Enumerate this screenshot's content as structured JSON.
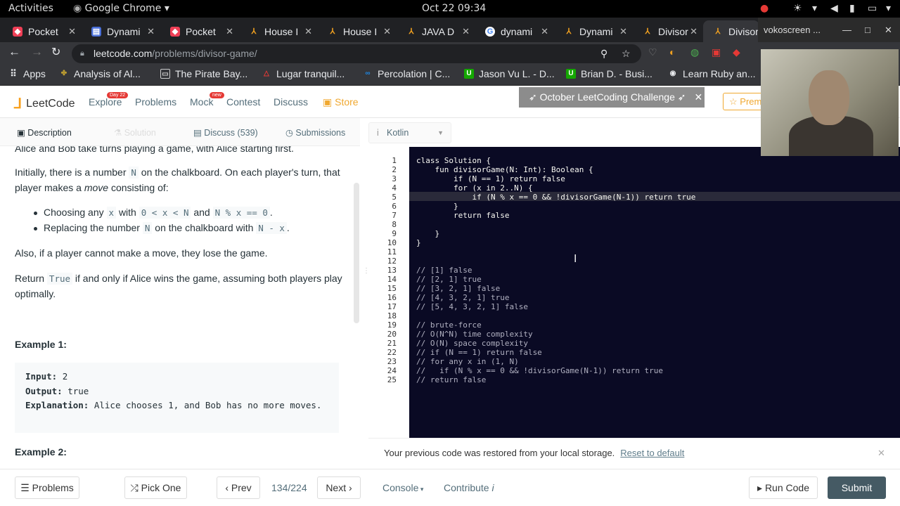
{
  "system": {
    "activities": "Activities",
    "app": "Google Chrome",
    "clock": "Oct 22  09:34"
  },
  "tabs": [
    {
      "label": "Pocket",
      "color": "#ef3f56"
    },
    {
      "label": "Dynami",
      "color": "#4a6fd8"
    },
    {
      "label": "Pocket",
      "color": "#ef3f56"
    },
    {
      "label": "House I",
      "color": "#f0a020"
    },
    {
      "label": "House I",
      "color": "#f0a020"
    },
    {
      "label": "JAVA D",
      "color": "#f0a020"
    },
    {
      "label": "dynami",
      "color": "#4285f4"
    },
    {
      "label": "Dynami",
      "color": "#f0a020"
    },
    {
      "label": "Divisor",
      "color": "#f0a020"
    },
    {
      "label": "Divisor",
      "color": "#f0a020"
    }
  ],
  "window": {
    "title": "vokoscreen ..."
  },
  "address": {
    "domain": "leetcode.com",
    "path": "/problems/divisor-game/"
  },
  "bookmarks": [
    {
      "label": "Apps",
      "color": "#4285f4"
    },
    {
      "label": "Analysis of Al...",
      "color": "#c0a030"
    },
    {
      "label": "The Pirate Bay...",
      "color": "#888888"
    },
    {
      "label": "Lugar tranquil...",
      "color": "#e53935"
    },
    {
      "label": "Percolation | C...",
      "color": "#1e88e5"
    },
    {
      "label": "Jason Vu L. - D...",
      "color": "#14a800"
    },
    {
      "label": "Brian D. - Busi...",
      "color": "#14a800"
    },
    {
      "label": "Learn Ruby an...",
      "color": "#666666"
    }
  ],
  "nav": {
    "logo": "LeetCode",
    "explore": "Explore",
    "explore_badge": "Day 22",
    "problems": "Problems",
    "mock": "Mock",
    "mock_badge": "new",
    "contest": "Contest",
    "discuss": "Discuss",
    "store": "Store",
    "banner": "October LeetCoding Challenge",
    "premium": "Prem"
  },
  "subtabs": {
    "description": "Description",
    "solution": "Solution",
    "discuss": "Discuss (539)",
    "submissions": "Submissions"
  },
  "language": "Kotlin",
  "desc": {
    "top": "Alice and Bob take turns playing a game, with Alice starting first.",
    "p1a": "Initially, there is a number",
    "p1code": "N",
    "p1b": "on the chalkboard.  On each player's turn, that player makes a",
    "p1em": "move",
    "p1c": "consisting of:",
    "li1a": "Choosing any",
    "li1c1": "x",
    "li1b": "with",
    "li1c2": "0 < x < N",
    "li1d": "and",
    "li1c3": "N % x == 0",
    "li2a": "Replacing the number",
    "li2c1": "N",
    "li2b": "on the chalkboard with",
    "li2c2": "N - x",
    "p2": "Also, if a player cannot make a move, they lose the game.",
    "p3a": "Return",
    "p3code": "True",
    "p3b": "if and only if Alice wins the game, assuming both players play optimally.",
    "ex1": "Example 1:",
    "input_l": "Input:",
    "input_v": "2",
    "output_l": "Output:",
    "output_v": "true",
    "expl_l": "Explanation:",
    "expl_v": "Alice chooses 1, and Bob has no more moves.",
    "ex2": "Example 2:"
  },
  "code": [
    "class Solution {",
    "    fun divisorGame(N: Int): Boolean {",
    "        if (N == 1) return false",
    "        for (x in 2..N) {",
    "            if (N % x == 0 && !divisorGame(N-1)) return true",
    "        }",
    "        return false",
    "",
    "    }",
    "}",
    "",
    "",
    "// [1] false",
    "// [2, 1] true",
    "// [3, 2, 1] false",
    "// [4, 3, 2, 1] true",
    "// [5, 4, 3, 2, 1] false",
    "",
    "// brute-force",
    "// O(N^N) time complexity",
    "// O(N) space complexity",
    "// if (N == 1) return false",
    "// for any x in (1, N)",
    "//   if (N % x == 0 && !divisorGame(N-1)) return true",
    "// return false"
  ],
  "restore": {
    "msg": "Your previous code was restored from your local storage.",
    "reset": "Reset to default"
  },
  "bottom": {
    "problems": "Problems",
    "pick": "Pick One",
    "prev": "Prev",
    "count": "134/224",
    "next": "Next",
    "console": "Console",
    "contribute": "Contribute",
    "run": "Run Code",
    "submit": "Submit"
  }
}
